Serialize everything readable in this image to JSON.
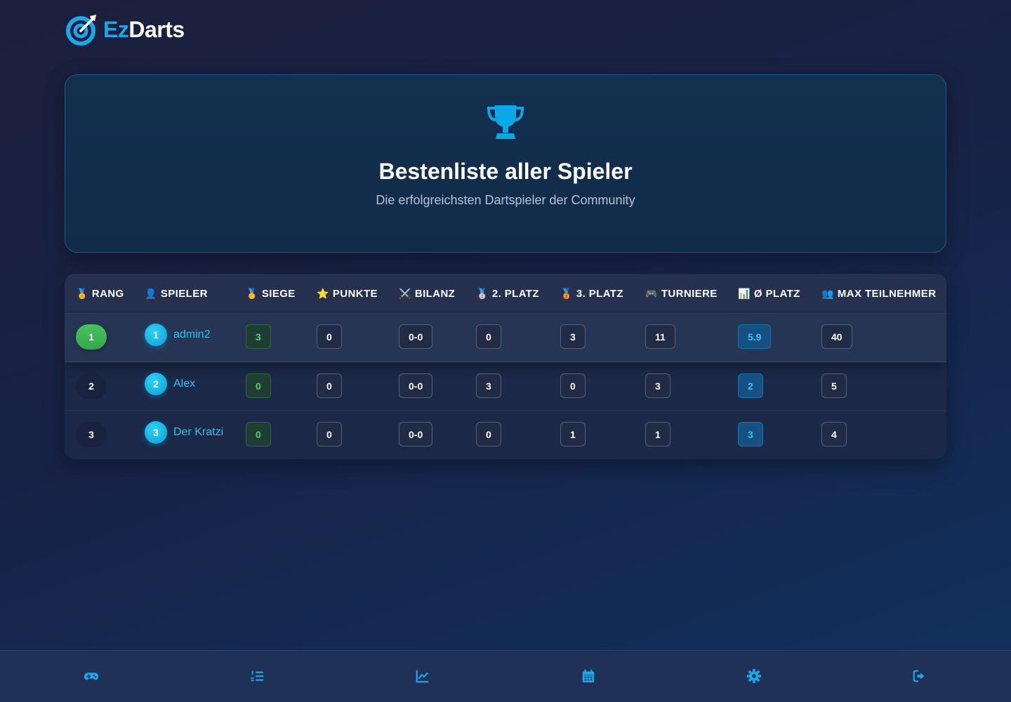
{
  "brand": {
    "part1": "Ez",
    "part2": "Darts",
    "accent": "#1ea7e8"
  },
  "hero": {
    "icon": "trophy-icon",
    "title": "Bestenliste aller Spieler",
    "subtitle": "Die erfolgreichsten Dartspieler der Community"
  },
  "table": {
    "columns": [
      {
        "emoji": "🏅",
        "label": "RANG"
      },
      {
        "emoji": "👤",
        "label": "SPIELER"
      },
      {
        "emoji": "🥇",
        "label": "SIEGE"
      },
      {
        "emoji": "⭐",
        "label": "PUNKTE"
      },
      {
        "emoji": "⚔️",
        "label": "BILANZ"
      },
      {
        "emoji": "🥈",
        "label": "2. PLATZ"
      },
      {
        "emoji": "🥉",
        "label": "3. PLATZ"
      },
      {
        "emoji": "🎮",
        "label": "TURNIERE"
      },
      {
        "emoji": "📊",
        "label": "Ø PLATZ"
      },
      {
        "emoji": "👥",
        "label": "MAX TEILNEHMER"
      }
    ],
    "rows": [
      {
        "rank": "1",
        "avatar": "1",
        "name": "admin2",
        "siege": "3",
        "punkte": "0",
        "bilanz": "0-0",
        "platz2": "0",
        "platz3": "3",
        "turniere": "11",
        "avg_platz": "5.9",
        "max_teilnehmer": "40"
      },
      {
        "rank": "2",
        "avatar": "2",
        "name": "Alex",
        "siege": "0",
        "punkte": "0",
        "bilanz": "0-0",
        "platz2": "3",
        "platz3": "0",
        "turniere": "3",
        "avg_platz": "2",
        "max_teilnehmer": "5"
      },
      {
        "rank": "3",
        "avatar": "3",
        "name": "Der Kratzi",
        "siege": "0",
        "punkte": "0",
        "bilanz": "0-0",
        "platz2": "0",
        "platz3": "1",
        "turniere": "1",
        "avg_platz": "3",
        "max_teilnehmer": "4"
      }
    ]
  },
  "nav": {
    "items": [
      {
        "icon": "gamepad-icon"
      },
      {
        "icon": "ordered-list-icon"
      },
      {
        "icon": "chart-line-icon"
      },
      {
        "icon": "calendar-icon"
      },
      {
        "icon": "gear-icon"
      },
      {
        "icon": "logout-icon"
      }
    ],
    "color": "#1ea7e8"
  }
}
